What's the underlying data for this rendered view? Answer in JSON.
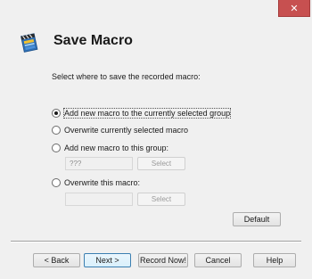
{
  "window": {
    "close_glyph": "✕"
  },
  "header": {
    "title": "Save Macro",
    "icon": "clapperboard-macro-icon"
  },
  "instruction": "Select where to save the recorded macro:",
  "options": [
    {
      "label": "Add new macro to the currently selected group",
      "selected": true
    },
    {
      "label": "Overwrite currently selected macro",
      "selected": false
    },
    {
      "label": "Add new macro to this group:",
      "selected": false
    },
    {
      "label": "Overwrite this macro:",
      "selected": false
    }
  ],
  "group_field": {
    "value": "???",
    "select_label": "Select"
  },
  "macro_field": {
    "value": "",
    "select_label": "Select"
  },
  "default_button": "Default",
  "footer": {
    "back": "< Back",
    "next": "Next >",
    "record_now": "Record Now!",
    "cancel": "Cancel",
    "help": "Help"
  },
  "colors": {
    "close_button": "#c75050",
    "background": "#f0f0f0",
    "primary_border": "#3c7fb1"
  }
}
